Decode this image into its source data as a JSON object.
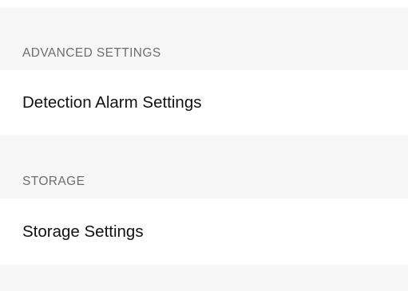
{
  "sections": [
    {
      "header": "ADVANCED SETTINGS",
      "items": [
        {
          "label": "Detection Alarm Settings"
        }
      ]
    },
    {
      "header": "STORAGE",
      "items": [
        {
          "label": "Storage Settings"
        }
      ]
    }
  ],
  "colors": {
    "group_background": "#f7f7f7",
    "row_background": "#ffffff",
    "header_text": "#6e6e6e",
    "row_text": "#111111"
  }
}
